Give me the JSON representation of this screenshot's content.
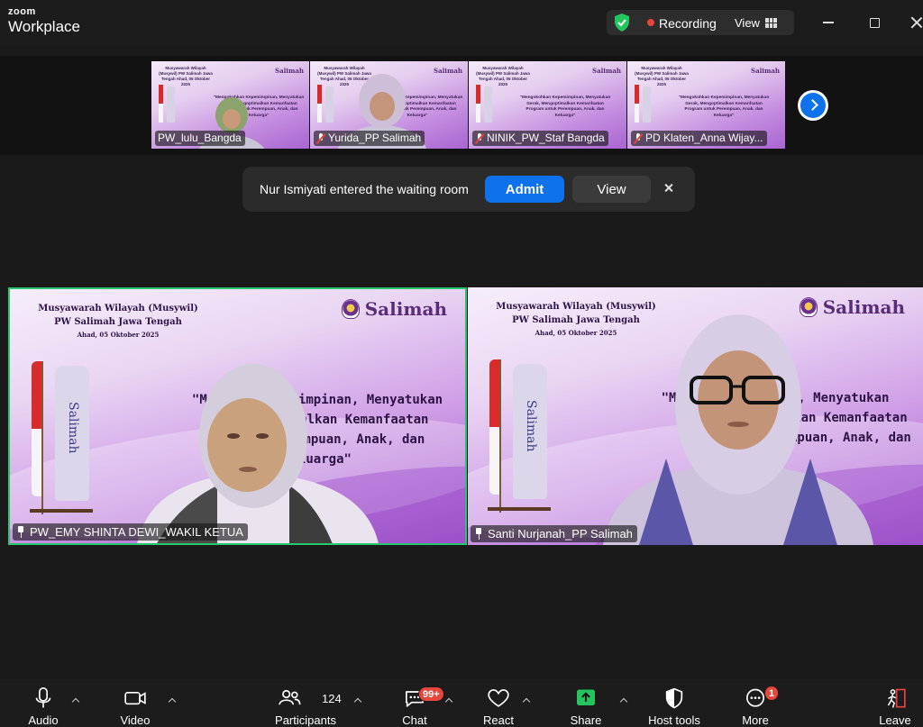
{
  "app": {
    "brand_top": "zoom",
    "brand_bottom": "Workplace"
  },
  "titlebar": {
    "recording_label": "Recording",
    "view_label": "View",
    "security_color": "#22c55e"
  },
  "thumbnails": [
    {
      "name": "PW_lulu_Bangda",
      "muted": false
    },
    {
      "name": "Yurida_PP Salimah",
      "muted": true
    },
    {
      "name": "NINIK_PW_Staf Bangda",
      "muted": true
    },
    {
      "name": "PD Klaten_Anna Wijay...",
      "muted": true
    }
  ],
  "thumb_slide": {
    "heading": "Musyawarah Wilayah (Musywil) PW Salimah Jawa Tengah Ahad, 05 Oktober 2025",
    "logo": "Salimah",
    "quote": "\"Mengokohkan Kepemimpinan, Menyatukan Gerak, Mengoptimalkan Kemanfaatan Program untuk Perempuan, Anak, dan Keluarga\""
  },
  "toast": {
    "message": "Nur Ismiyati entered the waiting room",
    "admit_label": "Admit",
    "view_label": "View"
  },
  "tiles": [
    {
      "name": "PW_EMY SHINTA DEWI_WAKIL KETUA",
      "slide_title": "Musyawarah Wilayah (Musywil)",
      "slide_subtitle": "PW Salimah Jawa Tengah",
      "slide_date": "Ahad, 05 Oktober 2025",
      "logo": "Salimah",
      "flag_text": "Salimah",
      "quote_l1": "\"M        epemimpinan, Menyatukan",
      "quote_l2": "ptimalkan Kemanfaatan",
      "quote_l3": "Perempuan, Anak, dan",
      "quote_l4": "Keluarga\""
    },
    {
      "name": "Santi Nurjanah_PP Salimah",
      "slide_title": "Musyawarah Wilayah (Musywil)",
      "slide_subtitle": "PW Salimah Jawa Tengah",
      "slide_date": "Ahad, 05 Oktober 2025",
      "logo": "Salimah",
      "flag_text": "Salimah",
      "quote_l1": "\"M        mimpinan, Menyatukan",
      "quote_l2": "alkan Kemanfaatan",
      "quote_l3": "rempuan, Anak, dan",
      "quote_l4": "ga\""
    }
  ],
  "toolbar": {
    "audio": "Audio",
    "video": "Video",
    "participants": "Participants",
    "participants_count": "124",
    "chat": "Chat",
    "chat_badge": "99+",
    "react": "React",
    "share": "Share",
    "host_tools": "Host tools",
    "more": "More",
    "more_badge": "1",
    "leave": "Leave",
    "share_color": "#22c55e",
    "leave_color": "#e8453c"
  }
}
